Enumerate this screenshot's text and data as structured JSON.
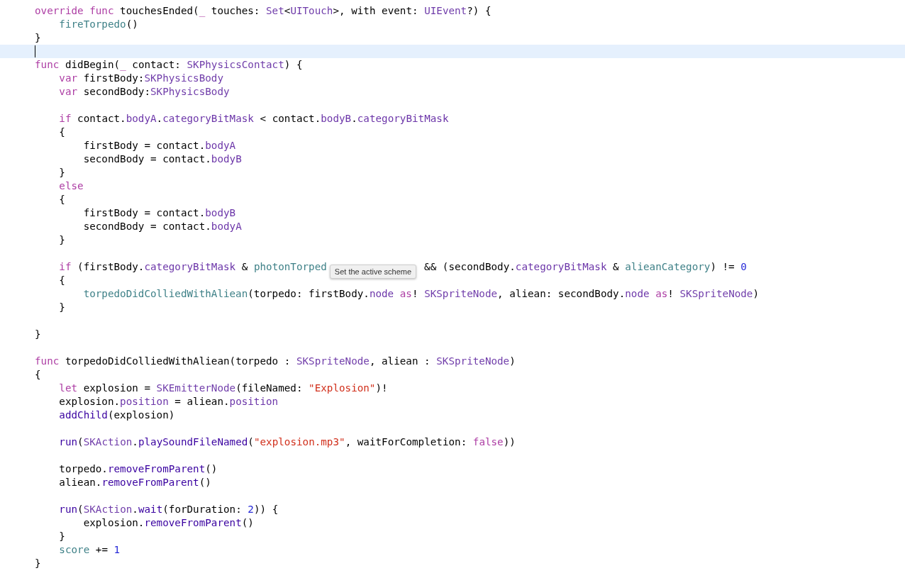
{
  "editor": {
    "lines": [
      {
        "current": false,
        "tokens": [
          {
            "kind": "keyword",
            "text": "override func"
          },
          {
            "kind": "plain",
            "text": " touchesEnded("
          },
          {
            "kind": "keyword",
            "text": "_"
          },
          {
            "kind": "plain",
            "text": " touches: "
          },
          {
            "kind": "type",
            "text": "Set"
          },
          {
            "kind": "plain",
            "text": "<"
          },
          {
            "kind": "type",
            "text": "UITouch"
          },
          {
            "kind": "plain",
            "text": ">, with event: "
          },
          {
            "kind": "type",
            "text": "UIEvent"
          },
          {
            "kind": "plain",
            "text": "?) {"
          }
        ]
      },
      {
        "current": false,
        "tokens": [
          {
            "kind": "project",
            "text": "    fireTorpedo"
          },
          {
            "kind": "plain",
            "text": "()"
          }
        ]
      },
      {
        "current": false,
        "tokens": [
          {
            "kind": "plain",
            "text": "}"
          }
        ]
      },
      {
        "current": true
      },
      {
        "current": false,
        "tokens": [
          {
            "kind": "keyword",
            "text": "func"
          },
          {
            "kind": "plain",
            "text": " didBegin("
          },
          {
            "kind": "keyword",
            "text": "_"
          },
          {
            "kind": "plain",
            "text": " contact: "
          },
          {
            "kind": "type",
            "text": "SKPhysicsContact"
          },
          {
            "kind": "plain",
            "text": ") {"
          }
        ]
      },
      {
        "current": false,
        "tokens": [
          {
            "kind": "keyword",
            "text": "    var"
          },
          {
            "kind": "plain",
            "text": " firstBody:"
          },
          {
            "kind": "type",
            "text": "SKPhysicsBody"
          }
        ]
      },
      {
        "current": false,
        "tokens": [
          {
            "kind": "keyword",
            "text": "    var"
          },
          {
            "kind": "plain",
            "text": " secondBody:"
          },
          {
            "kind": "type",
            "text": "SKPhysicsBody"
          }
        ]
      },
      {
        "current": false
      },
      {
        "current": false,
        "tokens": [
          {
            "kind": "keyword",
            "text": "    if"
          },
          {
            "kind": "plain",
            "text": " contact."
          },
          {
            "kind": "member",
            "text": "bodyA"
          },
          {
            "kind": "plain",
            "text": "."
          },
          {
            "kind": "member",
            "text": "categoryBitMask"
          },
          {
            "kind": "plain",
            "text": " < contact."
          },
          {
            "kind": "member",
            "text": "bodyB"
          },
          {
            "kind": "plain",
            "text": "."
          },
          {
            "kind": "member",
            "text": "categoryBitMask"
          }
        ]
      },
      {
        "current": false,
        "tokens": [
          {
            "kind": "plain",
            "text": "    {"
          }
        ]
      },
      {
        "current": false,
        "tokens": [
          {
            "kind": "plain",
            "text": "        firstBody = contact."
          },
          {
            "kind": "member",
            "text": "bodyA"
          }
        ]
      },
      {
        "current": false,
        "tokens": [
          {
            "kind": "plain",
            "text": "        secondBody = contact."
          },
          {
            "kind": "member",
            "text": "bodyB"
          }
        ]
      },
      {
        "current": false,
        "tokens": [
          {
            "kind": "plain",
            "text": "    }"
          }
        ]
      },
      {
        "current": false,
        "tokens": [
          {
            "kind": "keyword",
            "text": "    else"
          }
        ]
      },
      {
        "current": false,
        "tokens": [
          {
            "kind": "plain",
            "text": "    {"
          }
        ]
      },
      {
        "current": false,
        "tokens": [
          {
            "kind": "plain",
            "text": "        firstBody = contact."
          },
          {
            "kind": "member",
            "text": "bodyB"
          }
        ]
      },
      {
        "current": false,
        "tokens": [
          {
            "kind": "plain",
            "text": "        secondBody = contact."
          },
          {
            "kind": "member",
            "text": "bodyA"
          }
        ]
      },
      {
        "current": false,
        "tokens": [
          {
            "kind": "plain",
            "text": "    }"
          }
        ]
      },
      {
        "current": false
      },
      {
        "current": false,
        "tokens": [
          {
            "kind": "keyword",
            "text": "    if"
          },
          {
            "kind": "plain",
            "text": " (firstBody."
          },
          {
            "kind": "member",
            "text": "categoryBitMask"
          },
          {
            "kind": "plain",
            "text": " & "
          },
          {
            "kind": "project",
            "text": "photonTorped"
          },
          {
            "kind": "tooltip",
            "text": "Set the active scheme"
          },
          {
            "kind": "plain",
            "text": "&& (secondBody."
          },
          {
            "kind": "member",
            "text": "categoryBitMask"
          },
          {
            "kind": "plain",
            "text": " & "
          },
          {
            "kind": "project",
            "text": "alieanCategory"
          },
          {
            "kind": "plain",
            "text": ") != "
          },
          {
            "kind": "number",
            "text": "0"
          }
        ]
      },
      {
        "current": false,
        "tokens": [
          {
            "kind": "plain",
            "text": "    {"
          }
        ]
      },
      {
        "current": false,
        "tokens": [
          {
            "kind": "project",
            "text": "        torpedoDidColliedWithAliean"
          },
          {
            "kind": "plain",
            "text": "(torpedo: firstBody."
          },
          {
            "kind": "member",
            "text": "node"
          },
          {
            "kind": "keyword",
            "text": " as"
          },
          {
            "kind": "plain",
            "text": "! "
          },
          {
            "kind": "type",
            "text": "SKSpriteNode"
          },
          {
            "kind": "plain",
            "text": ", aliean: secondBody."
          },
          {
            "kind": "member",
            "text": "node"
          },
          {
            "kind": "keyword",
            "text": " as"
          },
          {
            "kind": "plain",
            "text": "! "
          },
          {
            "kind": "type",
            "text": "SKSpriteNode"
          },
          {
            "kind": "plain",
            "text": ")"
          }
        ]
      },
      {
        "current": false,
        "tokens": [
          {
            "kind": "plain",
            "text": "    }"
          }
        ]
      },
      {
        "current": false
      },
      {
        "current": false,
        "tokens": [
          {
            "kind": "plain",
            "text": "}"
          }
        ]
      },
      {
        "current": false
      },
      {
        "current": false,
        "tokens": [
          {
            "kind": "keyword",
            "text": "func"
          },
          {
            "kind": "plain",
            "text": " torpedoDidColliedWithAliean(torpedo : "
          },
          {
            "kind": "type",
            "text": "SKSpriteNode"
          },
          {
            "kind": "plain",
            "text": ", aliean : "
          },
          {
            "kind": "type",
            "text": "SKSpriteNode"
          },
          {
            "kind": "plain",
            "text": ")"
          }
        ]
      },
      {
        "current": false,
        "tokens": [
          {
            "kind": "plain",
            "text": "{"
          }
        ]
      },
      {
        "current": false,
        "tokens": [
          {
            "kind": "keyword",
            "text": "    let"
          },
          {
            "kind": "plain",
            "text": " explosion = "
          },
          {
            "kind": "type",
            "text": "SKEmitterNode"
          },
          {
            "kind": "plain",
            "text": "(fileNamed: "
          },
          {
            "kind": "string",
            "text": "\"Explosion\""
          },
          {
            "kind": "plain",
            "text": ")!"
          }
        ]
      },
      {
        "current": false,
        "tokens": [
          {
            "kind": "plain",
            "text": "    explosion."
          },
          {
            "kind": "member",
            "text": "position"
          },
          {
            "kind": "plain",
            "text": " = aliean."
          },
          {
            "kind": "member",
            "text": "position"
          }
        ]
      },
      {
        "current": false,
        "tokens": [
          {
            "kind": "call",
            "text": "    addChild"
          },
          {
            "kind": "plain",
            "text": "(explosion)"
          }
        ]
      },
      {
        "current": false
      },
      {
        "current": false,
        "tokens": [
          {
            "kind": "call",
            "text": "    run"
          },
          {
            "kind": "plain",
            "text": "("
          },
          {
            "kind": "type",
            "text": "SKAction"
          },
          {
            "kind": "plain",
            "text": "."
          },
          {
            "kind": "call",
            "text": "playSoundFileNamed"
          },
          {
            "kind": "plain",
            "text": "("
          },
          {
            "kind": "string",
            "text": "\"explosion.mp3\""
          },
          {
            "kind": "plain",
            "text": ", waitForCompletion: "
          },
          {
            "kind": "keyword",
            "text": "false"
          },
          {
            "kind": "plain",
            "text": "))"
          }
        ]
      },
      {
        "current": false
      },
      {
        "current": false,
        "tokens": [
          {
            "kind": "plain",
            "text": "    torpedo."
          },
          {
            "kind": "call",
            "text": "removeFromParent"
          },
          {
            "kind": "plain",
            "text": "()"
          }
        ]
      },
      {
        "current": false,
        "tokens": [
          {
            "kind": "plain",
            "text": "    aliean."
          },
          {
            "kind": "call",
            "text": "removeFromParent"
          },
          {
            "kind": "plain",
            "text": "()"
          }
        ]
      },
      {
        "current": false
      },
      {
        "current": false,
        "tokens": [
          {
            "kind": "call",
            "text": "    run"
          },
          {
            "kind": "plain",
            "text": "("
          },
          {
            "kind": "type",
            "text": "SKAction"
          },
          {
            "kind": "plain",
            "text": "."
          },
          {
            "kind": "call",
            "text": "wait"
          },
          {
            "kind": "plain",
            "text": "(forDuration: "
          },
          {
            "kind": "number",
            "text": "2"
          },
          {
            "kind": "plain",
            "text": ")) {"
          }
        ]
      },
      {
        "current": false,
        "tokens": [
          {
            "kind": "plain",
            "text": "        explosion."
          },
          {
            "kind": "call",
            "text": "removeFromParent"
          },
          {
            "kind": "plain",
            "text": "()"
          }
        ]
      },
      {
        "current": false,
        "tokens": [
          {
            "kind": "plain",
            "text": "    }"
          }
        ]
      },
      {
        "current": false,
        "tokens": [
          {
            "kind": "project",
            "text": "    score"
          },
          {
            "kind": "plain",
            "text": " += "
          },
          {
            "kind": "number",
            "text": "1"
          }
        ]
      },
      {
        "current": false,
        "tokens": [
          {
            "kind": "plain",
            "text": "}"
          }
        ]
      }
    ]
  }
}
